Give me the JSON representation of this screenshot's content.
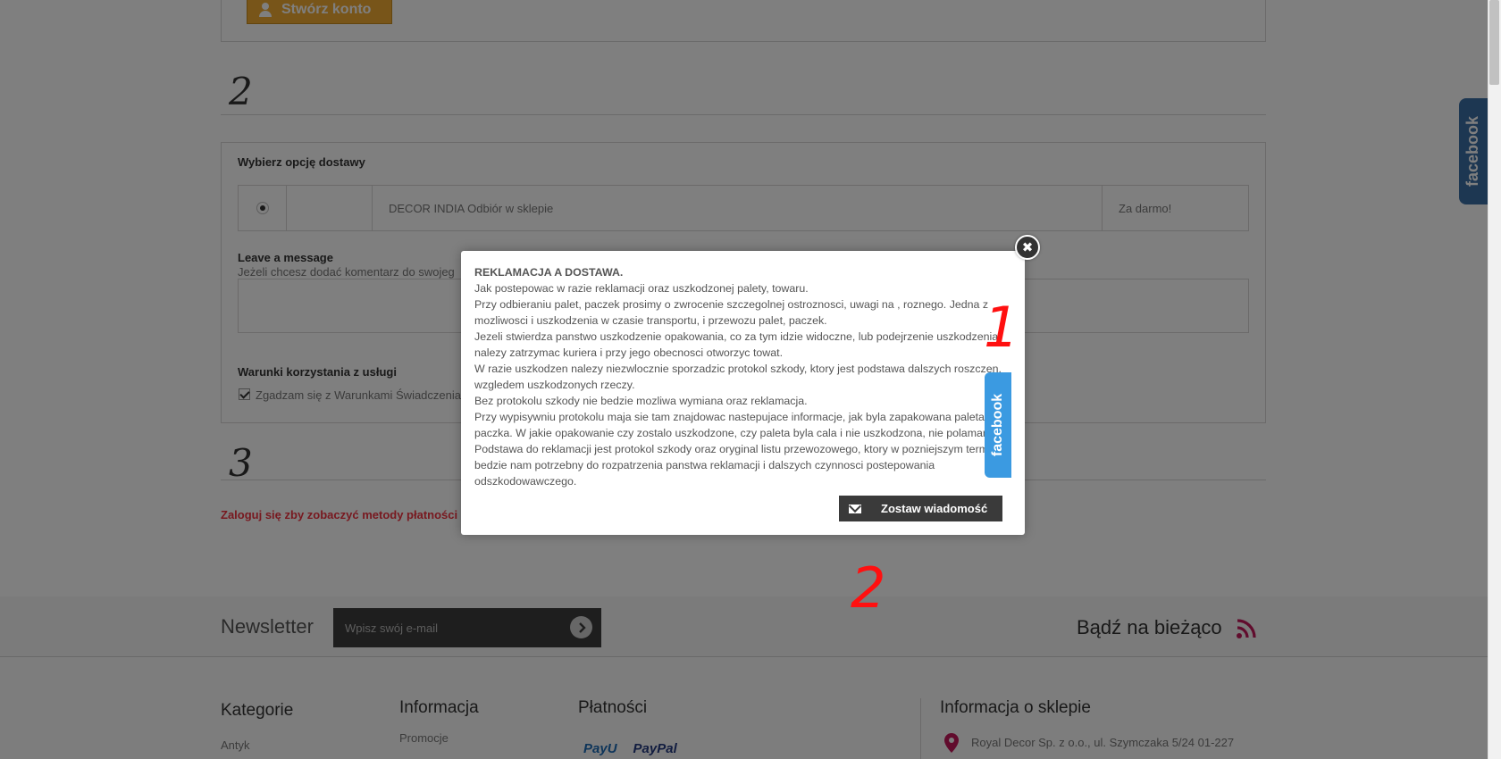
{
  "account": {
    "create_label": "Stwórz konto"
  },
  "steps": [
    "2",
    "3"
  ],
  "delivery": {
    "title": "Wybierz opcję dostawy",
    "carrier_name": "DECOR INDIA Odbiór w sklepie",
    "carrier_price": "Za darmo!"
  },
  "message": {
    "title": "Leave a message",
    "hint": "Jeżeli chcesz dodać komentarz do swojeg"
  },
  "terms": {
    "title": "Warunki korzystania z usługi",
    "agree_label": "Zgadzam się z Warunkami Świadczenia"
  },
  "login_note": "Zaloguj się zby zobaczyć metody płatności",
  "newsletter": {
    "title": "Newsletter",
    "placeholder": "Wpisz swój e-mail",
    "stay_updated": "Bądź na bieżąco"
  },
  "footer": {
    "categories": {
      "title": "Kategorie",
      "first_item": "Antyk"
    },
    "information": {
      "title": "Informacja",
      "first_item": "Promocje"
    },
    "payments": {
      "title": "Płatności",
      "logo_payu": "PayU",
      "logo_paypal": "PayPal"
    },
    "store_info": {
      "title": "Informacja o sklepie",
      "address": "Royal Decor Sp. z o.o., ul. Szymczaka 5/24 01-227"
    }
  },
  "facebook_tab": "facebook",
  "modal": {
    "heading": "REKLAMACJA A DOSTAWA.",
    "paragraphs": [
      " Jak postepowac w razie reklamacji oraz uszkodzonej palety, towaru.",
      "Przy odbieraniu palet, paczek prosimy o zwrocenie szczegolnej ostroznosci, uwagi na , roznego. Jedna z mozliwosci i uszkodzenia w czasie transportu, i przewozu palet, paczek.",
      "Jezeli stwierdza panstwo uszkodzenie opakowania, co za tym idzie widoczne, lub podejrzenie uszkodzenia nalezy zatrzymac kuriera i przy jego obecnosci otworzyc towat.",
      "W razie uszkodzen nalezy niezwlocznie  sporzadzic protokol szkody, ktory jest podstawa dalszych roszczen, wzgledem uszkodzonych rzeczy.",
      "Bez protokolu szkody nie bedzie mozliwa wymiana oraz reklamacja.",
      "Przy wypisywniu protokolu maja sie tam znajdowac nastepujace informacje, jak byla zapakowana paleta, paczka. W jakie opakowanie czy zostalo uszkodzone, czy paleta byla cala i nie uszkodzona, nie polamana.",
      "Podstawa do reklamacji jest protokol szkody oraz oryginal listu przewozowego, ktory w pozniejszym terminie bedzie nam potrzebny do rozpatrzenia panstwa reklamacji i dalszych czynnosci postepowania odszkodowawczego."
    ],
    "leave_message_label": "Zostaw wiadomość",
    "facebook_label": "facebook",
    "close_glyph": "✖"
  },
  "annotations": [
    "1",
    "2"
  ],
  "colors": {
    "accent_orange": "#f0ab33",
    "facebook_blue": "#3b9ae1",
    "error_red": "#f13340",
    "annotation_red": "#ff1010"
  }
}
